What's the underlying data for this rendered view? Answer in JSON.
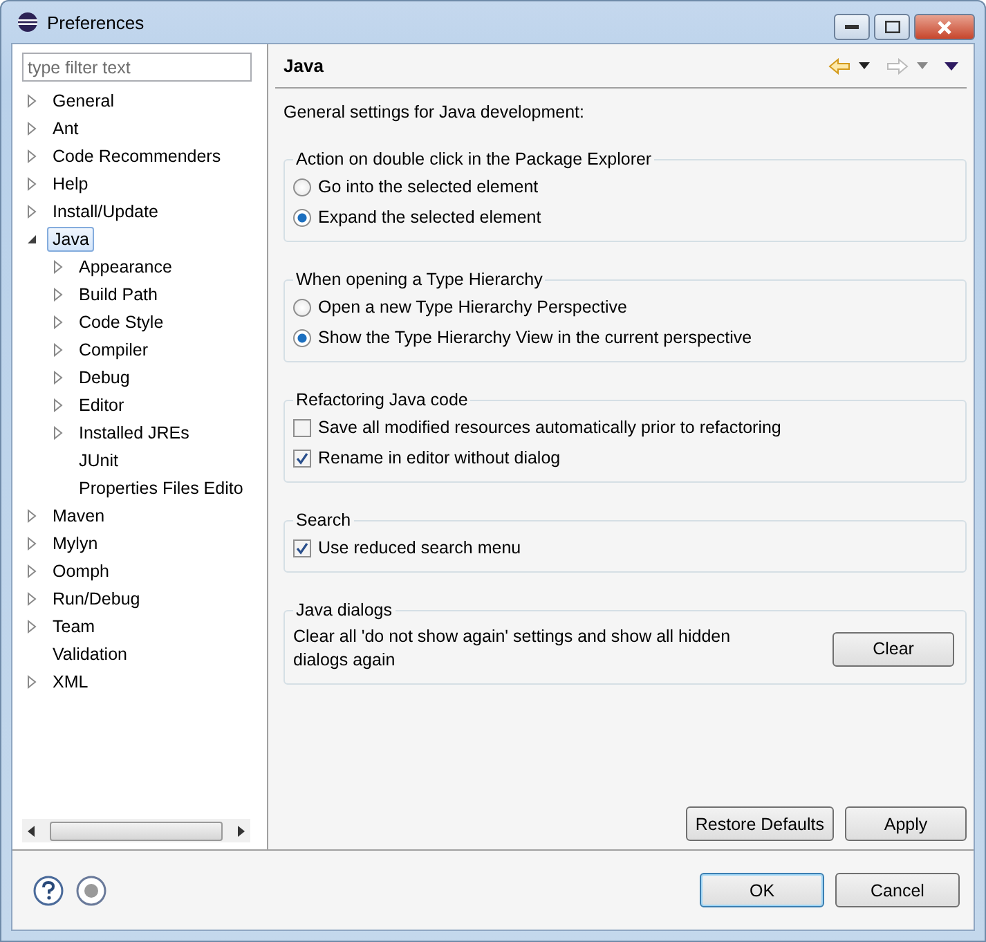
{
  "window": {
    "title": "Preferences"
  },
  "filter": {
    "placeholder": "type filter text"
  },
  "tree": [
    {
      "label": "General",
      "kind": "node",
      "expanded": false,
      "selected": false
    },
    {
      "label": "Ant",
      "kind": "node",
      "expanded": false,
      "selected": false
    },
    {
      "label": "Code Recommenders",
      "kind": "node",
      "expanded": false,
      "selected": false
    },
    {
      "label": "Help",
      "kind": "node",
      "expanded": false,
      "selected": false
    },
    {
      "label": "Install/Update",
      "kind": "node",
      "expanded": false,
      "selected": false
    },
    {
      "label": "Java",
      "kind": "node",
      "expanded": true,
      "selected": true,
      "children": [
        {
          "label": "Appearance",
          "kind": "node",
          "expanded": false,
          "selected": false
        },
        {
          "label": "Build Path",
          "kind": "node",
          "expanded": false,
          "selected": false
        },
        {
          "label": "Code Style",
          "kind": "node",
          "expanded": false,
          "selected": false
        },
        {
          "label": "Compiler",
          "kind": "node",
          "expanded": false,
          "selected": false
        },
        {
          "label": "Debug",
          "kind": "node",
          "expanded": false,
          "selected": false
        },
        {
          "label": "Editor",
          "kind": "node",
          "expanded": false,
          "selected": false
        },
        {
          "label": "Installed JREs",
          "kind": "node",
          "expanded": false,
          "selected": false
        },
        {
          "label": "JUnit",
          "kind": "leaf",
          "selected": false
        },
        {
          "label": "Properties Files Edito",
          "kind": "leaf",
          "selected": false
        }
      ]
    },
    {
      "label": "Maven",
      "kind": "node",
      "expanded": false,
      "selected": false
    },
    {
      "label": "Mylyn",
      "kind": "node",
      "expanded": false,
      "selected": false
    },
    {
      "label": "Oomph",
      "kind": "node",
      "expanded": false,
      "selected": false
    },
    {
      "label": "Run/Debug",
      "kind": "node",
      "expanded": false,
      "selected": false
    },
    {
      "label": "Team",
      "kind": "node",
      "expanded": false,
      "selected": false
    },
    {
      "label": "Validation",
      "kind": "leaf",
      "selected": false
    },
    {
      "label": "XML",
      "kind": "node",
      "expanded": false,
      "selected": false
    }
  ],
  "page": {
    "title": "Java",
    "description": "General settings for Java development:",
    "groups": [
      {
        "title": "Action on double click in the Package Explorer",
        "kind": "radio",
        "options": [
          {
            "label": "Go into the selected element",
            "selected": false
          },
          {
            "label": "Expand the selected element",
            "selected": true
          }
        ]
      },
      {
        "title": "When opening a Type Hierarchy",
        "kind": "radio",
        "options": [
          {
            "label": "Open a new Type Hierarchy Perspective",
            "selected": false
          },
          {
            "label": "Show the Type Hierarchy View in the current perspective",
            "selected": true
          }
        ]
      },
      {
        "title": "Refactoring Java code",
        "kind": "checkbox",
        "options": [
          {
            "label": "Save all modified resources automatically prior to refactoring",
            "checked": false
          },
          {
            "label": "Rename in editor without dialog",
            "checked": true
          }
        ]
      },
      {
        "title": "Search",
        "kind": "checkbox",
        "options": [
          {
            "label": "Use reduced search menu",
            "checked": true
          }
        ]
      },
      {
        "title": "Java dialogs",
        "kind": "action",
        "text": "Clear all 'do not show again' settings and show all hidden dialogs again",
        "button": "Clear"
      }
    ],
    "buttons": [
      "Restore Defaults",
      "Apply"
    ]
  },
  "footer": {
    "buttons": [
      {
        "label": "OK",
        "default": true
      },
      {
        "label": "Cancel",
        "default": false
      }
    ]
  }
}
